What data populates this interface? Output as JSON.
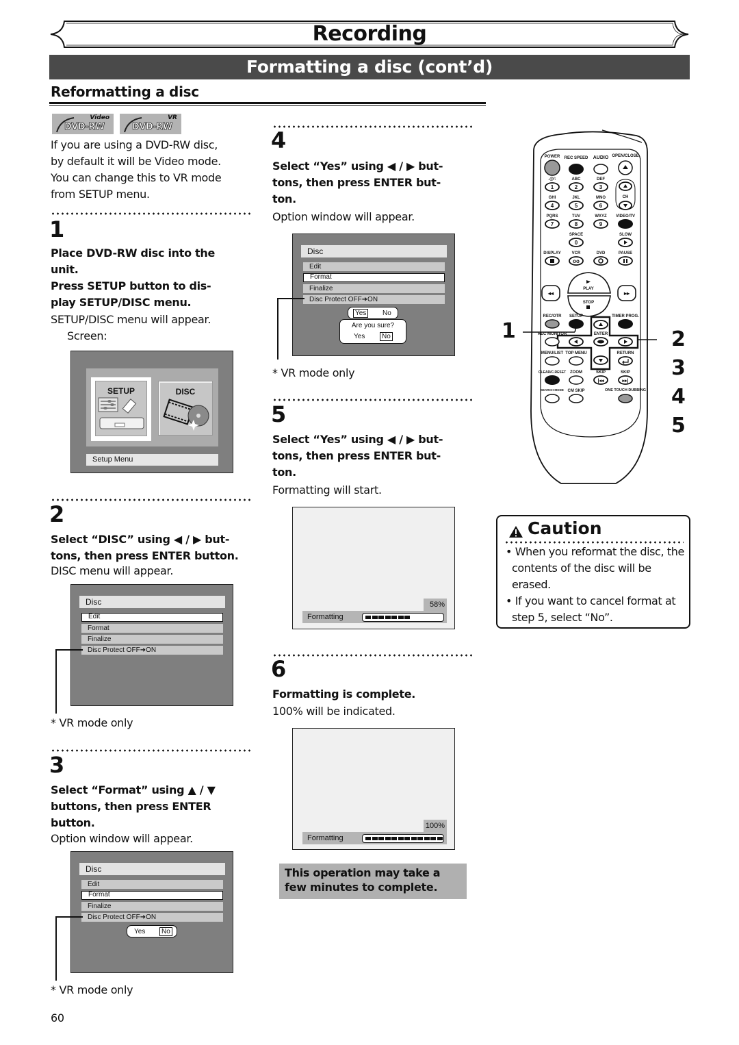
{
  "header": {
    "chapter_title": "Recording",
    "section_title": "Formatting a disc (cont’d)",
    "subheading": "Reformatting a disc"
  },
  "disc_logos": [
    {
      "mode": "Video",
      "label": "DVD-RW"
    },
    {
      "mode": "VR",
      "label": "DVD-RW"
    }
  ],
  "intro_text": [
    "If you are using a DVD-RW disc,",
    "by default it will be Video mode.",
    "You can change this to VR mode",
    "from SETUP menu."
  ],
  "steps": [
    {
      "number": "1",
      "instructions": [
        "Place DVD-RW disc into the",
        "unit.",
        "Press SETUP button to dis-",
        "play SETUP/DISC menu."
      ],
      "result": [
        "SETUP/DISC menu will appear.",
        "Screen:"
      ],
      "screen": {
        "setup_tile": "SETUP",
        "disc_tile": "DISC",
        "status_bar": "Setup Menu"
      }
    },
    {
      "number": "2",
      "instructions": [
        "Select “DISC” using ◀ / ▶ but-",
        "tons, then press ENTER button."
      ],
      "result": [
        "DISC menu will appear."
      ],
      "screen": {
        "title": "Disc",
        "items": [
          "Edit",
          "Format",
          "Finalize",
          "Disc Protect OFF➜ON"
        ],
        "selected": "Edit"
      },
      "footnote": "* VR mode only"
    },
    {
      "number": "3",
      "instructions": [
        "Select “Format” using ▲ / ▼",
        "buttons, then press ENTER",
        "button."
      ],
      "result": [
        "Option window will appear."
      ],
      "screen": {
        "title": "Disc",
        "items": [
          "Edit",
          "Format",
          "Finalize",
          "Disc Protect OFF➜ON"
        ],
        "selected": "Format",
        "option": {
          "yes": "Yes",
          "no": "No",
          "selected": "No"
        }
      },
      "footnote": "* VR mode only"
    },
    {
      "number": "4",
      "instructions": [
        "Select “Yes” using ◀ / ▶ but-",
        "tons, then press ENTER but-",
        "ton."
      ],
      "result": [
        "Option window will appear."
      ],
      "screen": {
        "title": "Disc",
        "items": [
          "Edit",
          "Format",
          "Finalize",
          "Disc Protect OFF➜ON"
        ],
        "selected": "Format",
        "option": {
          "yes": "Yes",
          "no": "No",
          "selected": "Yes"
        },
        "confirm": {
          "question": "Are you sure?",
          "yes": "Yes",
          "no": "No",
          "selected": "No"
        }
      },
      "footnote": "* VR mode only"
    },
    {
      "number": "5",
      "instructions": [
        "Select “Yes” using ◀ / ▶ but-",
        "tons, then press ENTER but-",
        "ton."
      ],
      "result": [
        "Formatting will start."
      ],
      "screen": {
        "label": "Formatting",
        "percent_text": "58%",
        "progress": 0.58
      }
    },
    {
      "number": "6",
      "instructions": [
        "Formatting is complete."
      ],
      "result": [
        "100% will be indicated."
      ],
      "screen": {
        "label": "Formatting",
        "percent_text": "100%",
        "progress": 1.0
      }
    }
  ],
  "note": [
    "This operation may take a",
    "few minutes to complete."
  ],
  "remote": {
    "callouts": [
      "1",
      "2",
      "3",
      "4",
      "5"
    ],
    "buttons": {
      "power": "POWER",
      "rec_speed": "REC SPEED",
      "audio": "AUDIO",
      "open_close": "OPEN/CLOSE",
      "k1": ".@/:",
      "k2": "ABC",
      "k3": "DEF",
      "k4": "GHI",
      "k5": "JKL",
      "k6": "MNO",
      "k7": "PQRS",
      "k8": "TUV",
      "k9": "WXYZ",
      "k0": "SPACE",
      "n1": "1",
      "n2": "2",
      "n3": "3",
      "n4": "4",
      "n5": "5",
      "n6": "6",
      "n7": "7",
      "n8": "8",
      "n9": "9",
      "n0": "0",
      "ch": "CH",
      "video_tv": "VIDEO/TV",
      "slow": "SLOW",
      "display": "DISPLAY",
      "vcr": "VCR",
      "dvd": "DVD",
      "pause": "PAUSE",
      "play": "PLAY",
      "stop": "STOP",
      "rec_otr": "REC/OTR",
      "setup": "SETUP",
      "timer_prog": "TIMER PROG.",
      "rec_monitor": "REC MONITOR",
      "enter": "ENTER",
      "menu_list": "MENU/LIST",
      "top_menu": "TOP MENU",
      "return": "RETURN",
      "clear_reset": "CLEAR/C.RESET",
      "zoom": "ZOOM",
      "skip_back": "SKIP",
      "skip_fwd": "SKIP",
      "search_mode": "SEARCH MODE",
      "cm_skip": "CM SKIP",
      "one_touch_dubbing": "ONE TOUCH DUBBING"
    }
  },
  "caution": {
    "title": "Caution",
    "bullets": [
      "• When you reformat the disc, the contents of the disc will be erased.",
      "• If you want to cancel format at step 5, select “No”."
    ]
  },
  "page_number": "60"
}
